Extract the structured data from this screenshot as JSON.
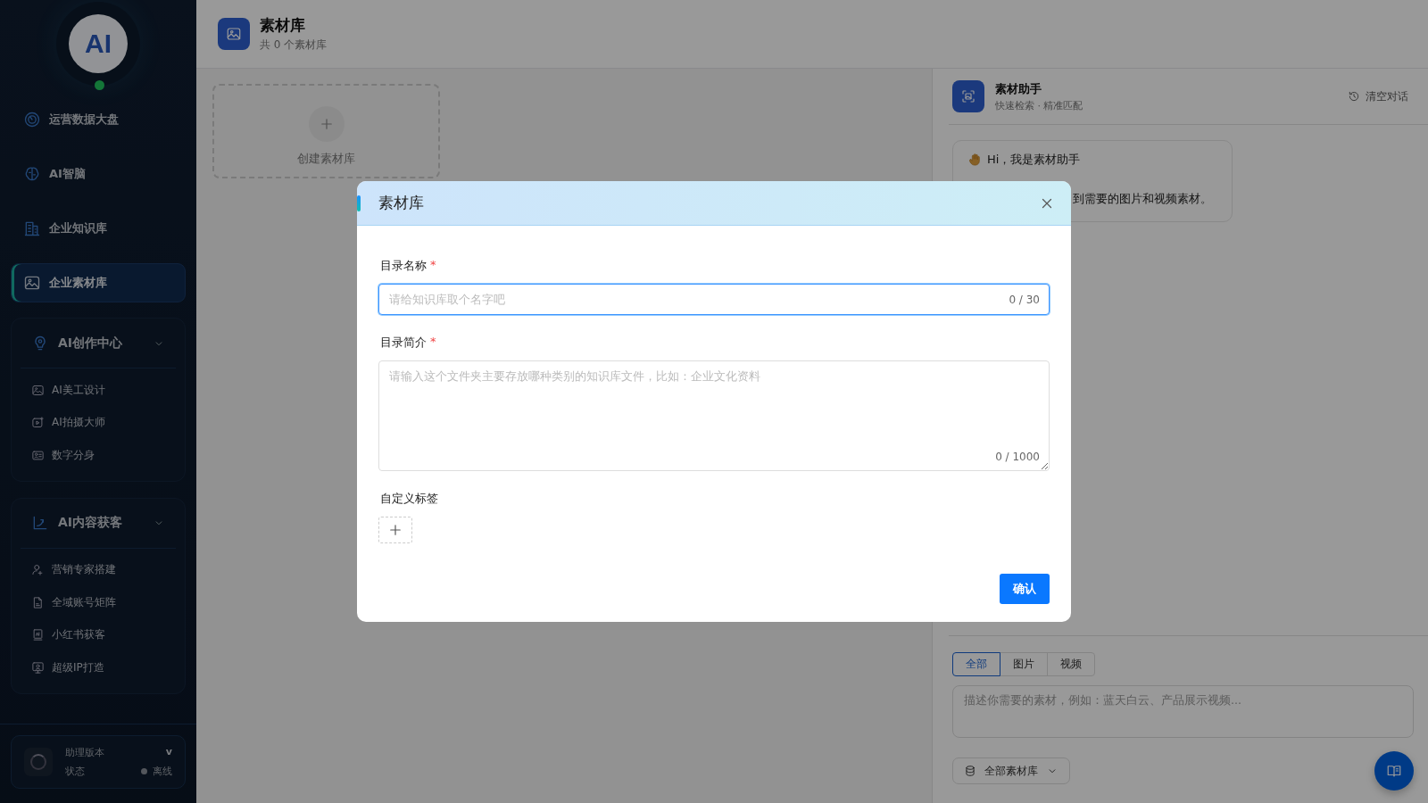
{
  "sidebar": {
    "logo": {
      "text": "AI",
      "online": true
    },
    "nav_items": [
      {
        "label": "运营数据大盘",
        "kind": "gauge",
        "selected": false
      },
      {
        "label": "AI智脑",
        "kind": "brain",
        "selected": false
      },
      {
        "label": "企业知识库",
        "kind": "building",
        "selected": false
      },
      {
        "label": "企业素材库",
        "kind": "image",
        "selected": true
      }
    ],
    "groups": [
      {
        "title": "AI创作中心",
        "kind": "bulb",
        "expanded": true,
        "items": [
          {
            "label": "AI美工设计",
            "kind": "image"
          },
          {
            "label": "AI拍摄大师",
            "kind": "camera"
          },
          {
            "label": "数字分身",
            "kind": "card"
          }
        ]
      },
      {
        "title": "AI内容获客",
        "kind": "chart",
        "expanded": true,
        "items": [
          {
            "label": "营销专家搭建",
            "kind": "user"
          },
          {
            "label": "全域账号矩阵",
            "kind": "doc"
          },
          {
            "label": "小红书获客",
            "kind": "book"
          },
          {
            "label": "超级IP打造",
            "kind": "screen"
          }
        ]
      }
    ],
    "version_card": {
      "label": "助理版本",
      "value": "v",
      "status_label": "状态",
      "status": "离线",
      "online": false
    }
  },
  "page_header": {
    "title": "素材库",
    "subtitle": "共 0 个素材库"
  },
  "create_card": {
    "label": "创建素材库"
  },
  "assistant": {
    "title": "素材助手",
    "subtitle": "快速检索 · 精准匹配",
    "clear_button": "清空对话",
    "message": {
      "greeting": "Hi，我是素材助手",
      "line": "到需要的图片和视频素材。"
    },
    "filters": [
      {
        "label": "全部",
        "selected": true
      },
      {
        "label": "图片",
        "selected": false
      },
      {
        "label": "视频",
        "selected": false
      }
    ],
    "input": {
      "placeholder": "描述你需要的素材，例如：蓝天白云、产品展示视频..."
    },
    "library_select": "全部素材库"
  },
  "dialog": {
    "title": "素材库",
    "fields": [
      {
        "kind": "input",
        "label": "目录名称",
        "mark": "*",
        "placeholder": "请给知识库取个名字吧",
        "counter": "0 / 30",
        "focused": true
      },
      {
        "kind": "textarea",
        "label": "目录简介",
        "mark": "*",
        "placeholder": "请输入这个文件夹主要存放哪种类别的知识库文件，比如：企业文化资料",
        "counter": "0 / 1000",
        "focused": false
      },
      {
        "kind": "tags",
        "label": "自定义标签"
      }
    ],
    "confirm": "确认"
  }
}
